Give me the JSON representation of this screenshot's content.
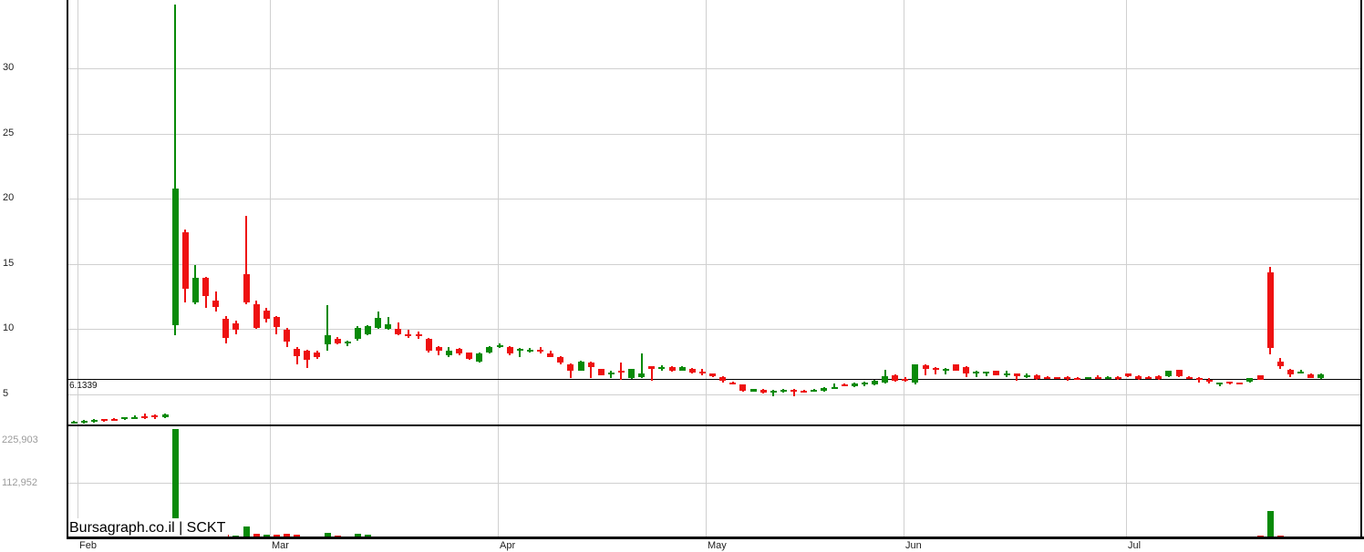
{
  "watermark": "Bursagraph.co.il | SCKT",
  "last_price_label": "6.1339",
  "colors": {
    "up": "#088a08",
    "down": "#ee1111",
    "grid": "#d0d0d0",
    "axis": "#000000",
    "tick_text": "#1e1e1e",
    "volume_text": "#9b9b9b"
  },
  "price_axis": {
    "ticks": [
      "30",
      "25",
      "20",
      "15",
      "10",
      "5"
    ]
  },
  "volume_axis": {
    "labels": [
      "225,903",
      "112,952"
    ]
  },
  "month_labels": [
    "Feb",
    "Mar",
    "Apr",
    "May",
    "Jun",
    "Jul"
  ],
  "chart_data": {
    "type": "candlestick+volume",
    "title": "Bursagraph.co.il | SCKT",
    "symbol": "SCKT",
    "last_price": 6.1339,
    "price_ticks": [
      30,
      25,
      20,
      15,
      10,
      5
    ],
    "price_ylim": [
      2.6,
      35.2
    ],
    "volume_ticks": [
      225903,
      112952
    ],
    "volume_gridline_value": 112952,
    "x_months": [
      "Feb",
      "Mar",
      "Apr",
      "May",
      "Jun",
      "Jul"
    ],
    "month_boundary_indices": [
      0.5,
      19.5,
      42,
      62.5,
      82,
      104
    ],
    "legend": "none",
    "grid": "on",
    "columns": [
      "open",
      "high",
      "low",
      "close",
      "volume"
    ],
    "volume_color_overrides": {
      "16": "up",
      "17": "up",
      "19": "up",
      "118": "up"
    },
    "candles": [
      [
        2.8,
        2.95,
        2.7,
        2.9,
        500
      ],
      [
        2.85,
        3.0,
        2.75,
        2.95,
        400
      ],
      [
        2.9,
        3.05,
        2.8,
        3.0,
        600
      ],
      [
        3.05,
        3.1,
        2.9,
        2.95,
        350
      ],
      [
        3.1,
        3.15,
        2.95,
        3.0,
        450
      ],
      [
        3.05,
        3.25,
        3.0,
        3.2,
        700
      ],
      [
        3.1,
        3.35,
        3.05,
        3.25,
        800
      ],
      [
        3.3,
        3.5,
        3.1,
        3.2,
        900
      ],
      [
        3.35,
        3.4,
        3.1,
        3.2,
        700
      ],
      [
        3.2,
        3.5,
        3.15,
        3.45,
        900
      ],
      [
        10.3,
        34.9,
        9.5,
        20.8,
        225903
      ],
      [
        17.4,
        17.6,
        12.0,
        13.1,
        9500
      ],
      [
        12.0,
        14.9,
        11.9,
        13.9,
        6500
      ],
      [
        13.9,
        14.0,
        11.6,
        12.5,
        5000
      ],
      [
        12.2,
        12.9,
        11.3,
        11.7,
        4200
      ],
      [
        10.8,
        11.0,
        8.9,
        9.3,
        6000
      ],
      [
        10.45,
        10.6,
        9.6,
        9.95,
        3500
      ],
      [
        14.2,
        18.7,
        11.9,
        12.0,
        23000
      ],
      [
        11.9,
        12.2,
        10.0,
        10.1,
        8500
      ],
      [
        11.4,
        11.6,
        10.5,
        10.8,
        6000
      ],
      [
        10.9,
        11.0,
        9.6,
        10.15,
        5200
      ],
      [
        9.9,
        10.1,
        8.6,
        9.0,
        7500
      ],
      [
        8.45,
        8.6,
        7.25,
        7.9,
        6400
      ],
      [
        8.3,
        8.4,
        7.0,
        7.6,
        700
      ],
      [
        8.2,
        8.3,
        7.7,
        7.8,
        600
      ],
      [
        8.8,
        11.8,
        8.3,
        9.5,
        10000
      ],
      [
        9.2,
        9.4,
        8.8,
        8.9,
        4500
      ],
      [
        8.85,
        9.1,
        8.7,
        9.0,
        600
      ],
      [
        9.2,
        10.2,
        9.1,
        10.1,
        7000
      ],
      [
        9.6,
        10.3,
        9.5,
        10.2,
        5500
      ],
      [
        10.1,
        11.3,
        10.0,
        10.85,
        900
      ],
      [
        10.0,
        10.9,
        9.9,
        10.35,
        800
      ],
      [
        10.0,
        10.5,
        9.5,
        9.6,
        700
      ],
      [
        9.6,
        9.9,
        9.3,
        9.5,
        500
      ],
      [
        9.55,
        9.8,
        9.2,
        9.45,
        400
      ],
      [
        9.25,
        9.3,
        8.2,
        8.3,
        600
      ],
      [
        8.6,
        8.7,
        7.95,
        8.3,
        500
      ],
      [
        8.0,
        8.6,
        7.8,
        8.3,
        400
      ],
      [
        8.45,
        8.5,
        8.0,
        8.1,
        300
      ],
      [
        8.15,
        8.2,
        7.6,
        7.7,
        500
      ],
      [
        7.5,
        8.2,
        7.4,
        8.1,
        600
      ],
      [
        8.15,
        8.7,
        8.1,
        8.6,
        400
      ],
      [
        8.65,
        8.9,
        8.5,
        8.75,
        300
      ],
      [
        8.6,
        8.65,
        8.0,
        8.1,
        400
      ],
      [
        8.3,
        8.5,
        7.85,
        8.45,
        350
      ],
      [
        8.3,
        8.55,
        8.2,
        8.4,
        300
      ],
      [
        8.4,
        8.6,
        8.1,
        8.3,
        250
      ],
      [
        8.1,
        8.35,
        7.8,
        7.85,
        400
      ],
      [
        7.85,
        7.9,
        7.3,
        7.4,
        500
      ],
      [
        7.3,
        7.35,
        6.2,
        6.8,
        600
      ],
      [
        6.8,
        7.55,
        6.75,
        7.5,
        400
      ],
      [
        7.4,
        7.45,
        6.2,
        7.05,
        450
      ],
      [
        6.9,
        6.95,
        6.4,
        6.45,
        350
      ],
      [
        6.6,
        6.75,
        6.2,
        6.65,
        250
      ],
      [
        6.8,
        7.4,
        6.1,
        6.75,
        400
      ],
      [
        6.2,
        6.95,
        6.15,
        6.9,
        300
      ],
      [
        6.3,
        8.1,
        6.2,
        6.55,
        450
      ],
      [
        7.1,
        7.15,
        6.0,
        6.9,
        350
      ],
      [
        7.0,
        7.2,
        6.8,
        7.05,
        200
      ],
      [
        7.05,
        7.1,
        6.7,
        6.77,
        250
      ],
      [
        6.8,
        7.1,
        6.75,
        7.06,
        300
      ],
      [
        6.94,
        7.0,
        6.6,
        6.66,
        200
      ],
      [
        6.7,
        6.9,
        6.4,
        6.6,
        250
      ],
      [
        6.55,
        6.6,
        6.3,
        6.36,
        350
      ],
      [
        6.3,
        6.35,
        5.9,
        6.0,
        400
      ],
      [
        5.9,
        5.95,
        5.75,
        5.8,
        200
      ],
      [
        5.7,
        5.75,
        5.2,
        5.25,
        450
      ],
      [
        5.2,
        5.4,
        5.15,
        5.35,
        250
      ],
      [
        5.3,
        5.35,
        5.05,
        5.1,
        200
      ],
      [
        5.2,
        5.3,
        4.8,
        5.25,
        300
      ],
      [
        5.2,
        5.35,
        5.1,
        5.3,
        150
      ],
      [
        5.3,
        5.4,
        4.85,
        5.2,
        250
      ],
      [
        5.25,
        5.3,
        5.1,
        5.15,
        200
      ],
      [
        5.25,
        5.35,
        5.2,
        5.3,
        150
      ],
      [
        5.25,
        5.5,
        5.2,
        5.45,
        250
      ],
      [
        5.4,
        5.8,
        5.35,
        5.5,
        300
      ],
      [
        5.75,
        5.8,
        5.6,
        5.65,
        200
      ],
      [
        5.6,
        5.85,
        5.55,
        5.8,
        250
      ],
      [
        5.85,
        5.95,
        5.6,
        5.9,
        200
      ],
      [
        5.7,
        6.05,
        5.65,
        6.0,
        300
      ],
      [
        5.85,
        6.85,
        5.8,
        6.35,
        700
      ],
      [
        6.45,
        6.5,
        5.95,
        6.0,
        400
      ],
      [
        6.15,
        6.3,
        5.95,
        6.1,
        250
      ],
      [
        5.9,
        7.3,
        5.75,
        7.25,
        800
      ],
      [
        7.2,
        7.25,
        6.45,
        6.9,
        450
      ],
      [
        7.0,
        7.05,
        6.5,
        6.85,
        350
      ],
      [
        6.8,
        7.0,
        6.5,
        6.95,
        250
      ],
      [
        7.25,
        7.3,
        6.75,
        6.8,
        300
      ],
      [
        7.05,
        7.1,
        6.3,
        6.6,
        350
      ],
      [
        6.55,
        6.75,
        6.3,
        6.7,
        200
      ],
      [
        6.6,
        6.72,
        6.35,
        6.7,
        150
      ],
      [
        6.78,
        6.8,
        6.4,
        6.45,
        250
      ],
      [
        6.55,
        6.8,
        6.3,
        6.6,
        200
      ],
      [
        6.55,
        6.6,
        6.0,
        6.34,
        300
      ],
      [
        6.35,
        6.55,
        6.25,
        6.45,
        150
      ],
      [
        6.45,
        6.5,
        6.1,
        6.15,
        200
      ],
      [
        6.3,
        6.35,
        6.2,
        6.25,
        100
      ],
      [
        6.28,
        6.3,
        6.15,
        6.2,
        150
      ],
      [
        6.3,
        6.35,
        6.0,
        6.25,
        200
      ],
      [
        6.25,
        6.3,
        6.1,
        6.15,
        100
      ],
      [
        6.2,
        6.3,
        6.15,
        6.27,
        150
      ],
      [
        6.3,
        6.4,
        6.15,
        6.25,
        200
      ],
      [
        6.2,
        6.35,
        6.15,
        6.3,
        150
      ],
      [
        6.32,
        6.35,
        6.05,
        6.28,
        200
      ],
      [
        6.55,
        6.6,
        6.3,
        6.35,
        200
      ],
      [
        6.34,
        6.45,
        6.1,
        6.15,
        150
      ],
      [
        6.3,
        6.35,
        6.2,
        6.25,
        100
      ],
      [
        6.38,
        6.4,
        6.1,
        6.17,
        150
      ],
      [
        6.36,
        6.8,
        6.3,
        6.78,
        300
      ],
      [
        6.83,
        6.85,
        6.3,
        6.34,
        350
      ],
      [
        6.3,
        6.35,
        6.2,
        6.25,
        150
      ],
      [
        6.25,
        6.3,
        5.85,
        6.1,
        200
      ],
      [
        6.06,
        6.2,
        5.8,
        5.92,
        150
      ],
      [
        5.78,
        5.9,
        5.6,
        5.87,
        200
      ],
      [
        5.92,
        5.95,
        5.75,
        5.78,
        100
      ],
      [
        5.88,
        5.9,
        5.78,
        5.85,
        100
      ],
      [
        5.92,
        6.25,
        5.9,
        6.22,
        250
      ],
      [
        6.4,
        6.45,
        6.05,
        6.1,
        3800
      ],
      [
        14.34,
        14.73,
        8.02,
        8.55,
        55000
      ],
      [
        7.5,
        7.75,
        6.9,
        7.1,
        3800
      ],
      [
        6.85,
        6.9,
        6.3,
        6.5,
        700
      ],
      [
        6.6,
        6.85,
        6.55,
        6.72,
        600
      ],
      [
        6.5,
        6.55,
        6.2,
        6.25,
        700
      ],
      [
        6.2,
        6.55,
        6.15,
        6.5,
        500
      ]
    ]
  }
}
